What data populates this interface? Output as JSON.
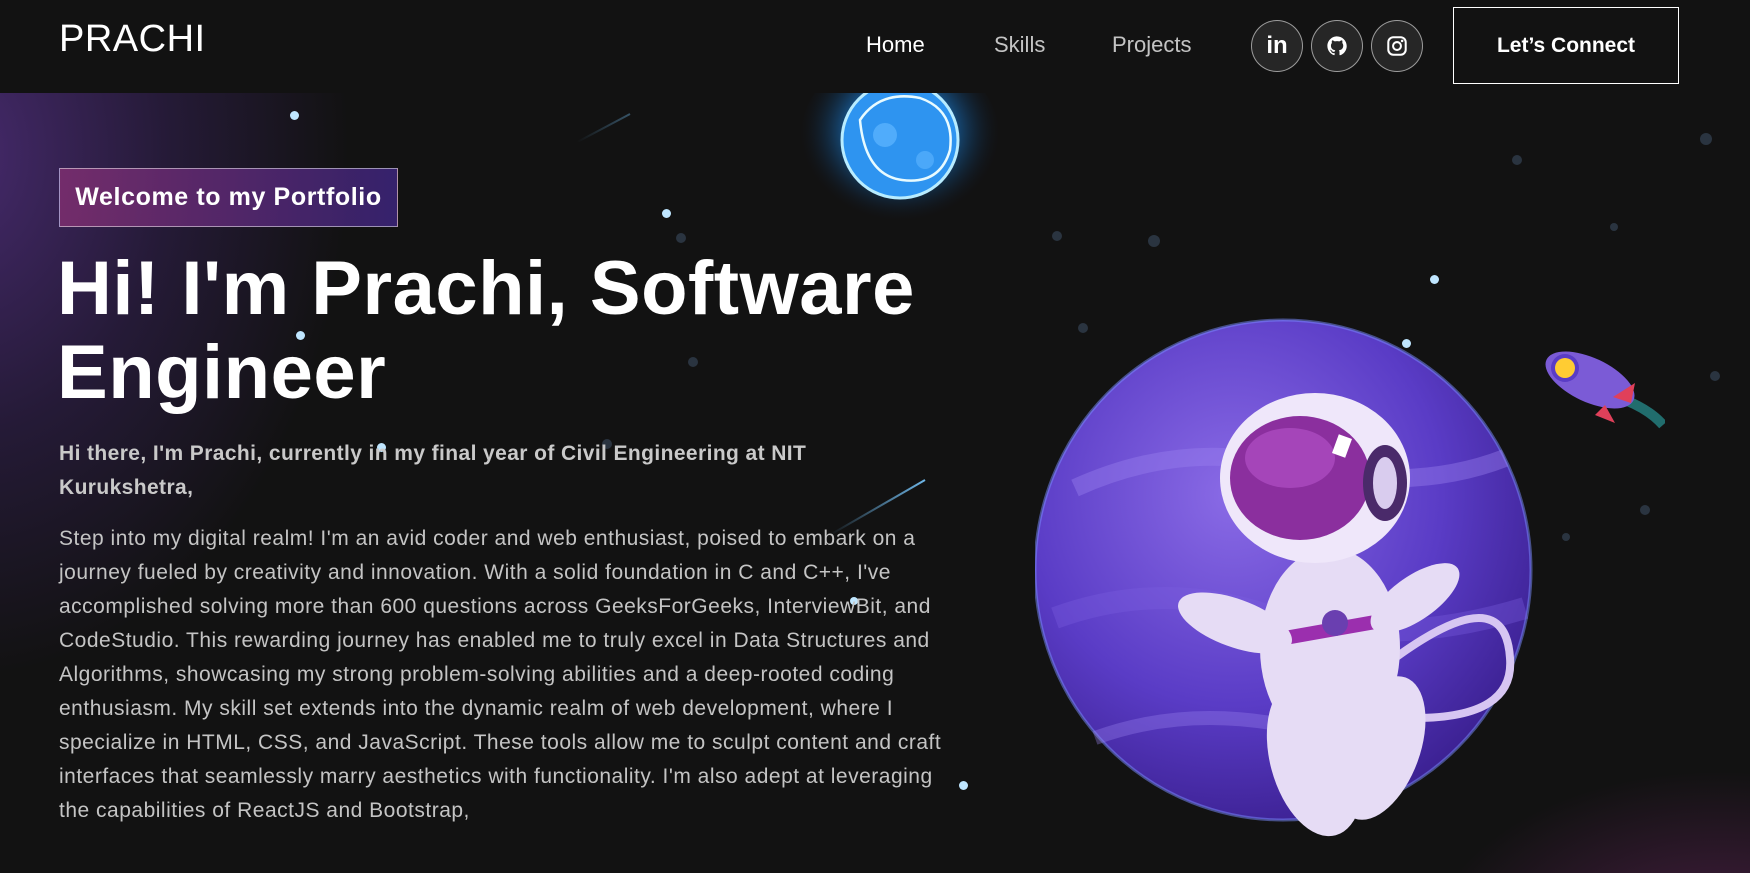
{
  "navbar": {
    "logo": "PRACHI",
    "links": [
      {
        "label": "Home"
      },
      {
        "label": "Skills"
      },
      {
        "label": "Projects"
      }
    ],
    "social": [
      {
        "label": "in",
        "icon": "linkedin-icon"
      },
      {
        "icon": "github-icon"
      },
      {
        "icon": "instagram-icon"
      }
    ],
    "connect_label": "Let’s Connect"
  },
  "hero": {
    "tagline": "Welcome to my Portfolio",
    "headline_line1": "Hi! I'm Prachi, Software",
    "headline_line2": "Engineer",
    "intro": "Hi there, I'm Prachi, currently in my final year of Civil Engineering at NIT Kurukshetra,",
    "about": "Step into my digital realm! I'm an avid coder and web enthusiast, poised to embark on a journey fueled by creativity and innovation. With a solid foundation in C and C++, I've accomplished solving more than 600 questions across GeeksForGeeks, InterviewBit, and CodeStudio. This rewarding journey has enabled me to truly excel in Data Structures and Algorithms, showcasing my strong problem-solving abilities and a deep-rooted coding enthusiasm. My skill set extends into the dynamic realm of web development, where I specialize in HTML, CSS, and JavaScript. These tools allow me to sculpt content and craft interfaces that seamlessly marry aesthetics with functionality. I'm also adept at leveraging the capabilities of ReactJS and Bootstrap,"
  },
  "colors": {
    "background": "#121212",
    "accent_purple": "#6a4fd0",
    "tagline_pink": "#aa367c",
    "tagline_violet": "#4a2fbd"
  }
}
